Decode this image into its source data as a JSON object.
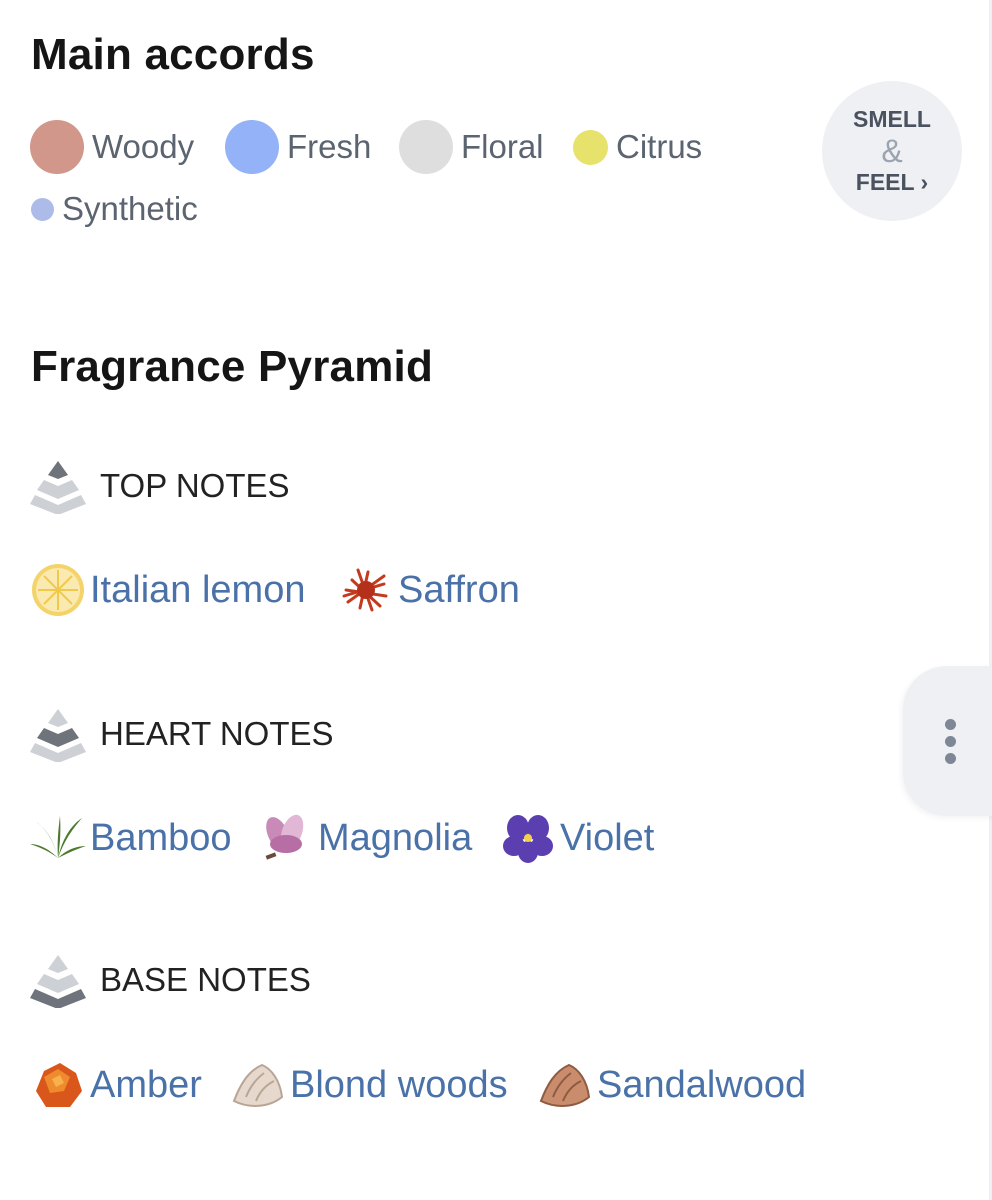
{
  "main_accords": {
    "title": "Main accords",
    "items": [
      {
        "label": "Woody",
        "color": "#d1978a"
      },
      {
        "label": "Fresh",
        "color": "#93b2f7"
      },
      {
        "label": "Floral",
        "color": "#dedede"
      },
      {
        "label": "Citrus",
        "color": "#e6e26c"
      },
      {
        "label": "Synthetic",
        "color": "#adbbe8"
      }
    ]
  },
  "smell_feel": {
    "line1": "SMELL",
    "amp": "&",
    "line2": "FEEL ›"
  },
  "pyramid": {
    "title": "Fragrance Pyramid",
    "top": {
      "label": "TOP NOTES",
      "notes": [
        {
          "name": "Italian lemon",
          "icon": "lemon-icon"
        },
        {
          "name": "Saffron",
          "icon": "saffron-icon"
        }
      ]
    },
    "heart": {
      "label": "HEART NOTES",
      "notes": [
        {
          "name": "Bamboo",
          "icon": "bamboo-icon"
        },
        {
          "name": "Magnolia",
          "icon": "magnolia-icon"
        },
        {
          "name": "Violet",
          "icon": "violet-icon"
        }
      ]
    },
    "base": {
      "label": "BASE NOTES",
      "notes": [
        {
          "name": "Amber",
          "icon": "amber-icon"
        },
        {
          "name": "Blond woods",
          "icon": "blond-woods-icon"
        },
        {
          "name": "Sandalwood",
          "icon": "sandalwood-icon"
        }
      ]
    }
  },
  "side_menu": {
    "icon": "more-vertical-icon"
  }
}
